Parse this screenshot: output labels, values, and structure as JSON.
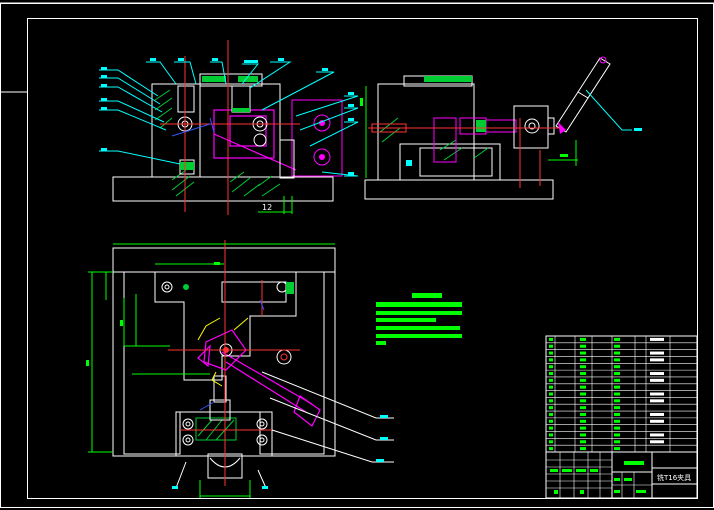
{
  "drawing": {
    "dimension_label": "12",
    "title_block_caption": "铣T16夹具",
    "colors": {
      "background": "#000000",
      "outline": "#ffffff",
      "part": "#ffffff",
      "dimension": "#00ff00",
      "hatch": "#00cc33",
      "moving_part": "#ff00ff",
      "leader": "#00ffff",
      "centerline": "#ff3333",
      "blue": "#3355ff"
    }
  }
}
